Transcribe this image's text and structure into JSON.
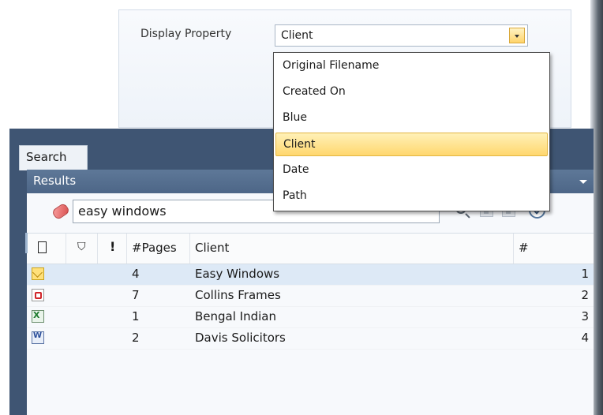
{
  "property_panel": {
    "label": "Display Property",
    "selected_value": "Client"
  },
  "dropdown": {
    "options": [
      "Original Filename",
      "Created On",
      "Blue",
      "Client",
      "Date",
      "Path"
    ],
    "selected": "Client"
  },
  "tab": {
    "label": "Search"
  },
  "results": {
    "title": "Results",
    "search_query": "easy windows",
    "columns": [
      "",
      "",
      "",
      "#Pages",
      "Client",
      "#"
    ],
    "rows": [
      {
        "icon": "email-icon",
        "pages": "4",
        "client": "Easy Windows",
        "num": "1",
        "selected": true
      },
      {
        "icon": "pdf-icon",
        "pages": "7",
        "client": "Collins Frames",
        "num": "2",
        "selected": false
      },
      {
        "icon": "excel-icon",
        "pages": "1",
        "client": "Bengal Indian",
        "num": "3",
        "selected": false
      },
      {
        "icon": "word-icon",
        "pages": "2",
        "client": "Davis Solicitors",
        "num": "4",
        "selected": false
      }
    ]
  },
  "colors": {
    "window_bg": "#3f5573",
    "results_header": "#5a7394",
    "selection_highlight": "#ffd76e",
    "row_selected": "#dde9f6"
  }
}
